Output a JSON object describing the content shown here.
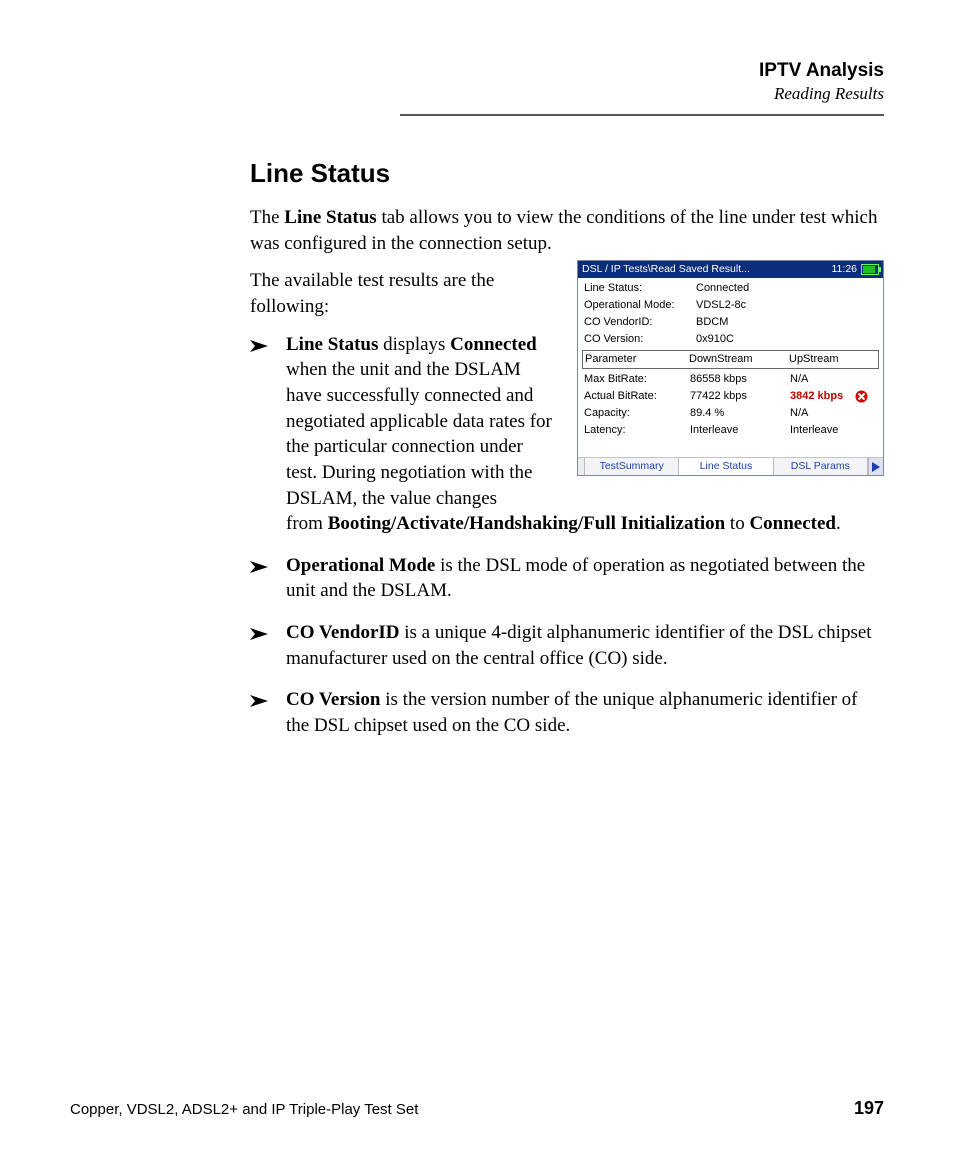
{
  "header": {
    "chapter": "IPTV Analysis",
    "section": "Reading Results"
  },
  "heading": "Line Status",
  "intro": {
    "sentence_part1": "The ",
    "sentence_bold": "Line Status",
    "sentence_part2": " tab allows you to view the conditions of the line under test which was configured in the connection setup.",
    "followup": "The available test results are the following:"
  },
  "bullets": [
    {
      "lead_bold": "Line Status",
      "lead_rest": " displays ",
      "lead_bold2": "Connected",
      "body_narrow": " when the unit and the DSLAM have successfully connected and negotiated applicable data rates for the particular connection under test. During negotiation with the DSLAM, the value changes",
      "body_full_part1": "from ",
      "body_full_bold": "Booting/Activate/Handshaking/Full Initialization",
      "body_full_part2": " to ",
      "body_full_bold2": "Connected",
      "body_full_part3": "."
    },
    {
      "lead_bold": "Operational Mode",
      "rest": " is the DSL mode of operation as negotiated between the unit and the DSLAM."
    },
    {
      "lead_bold": "CO VendorID",
      "rest": " is a unique 4-digit alphanumeric identifier of the DSL chipset manufacturer used on the central office (CO) side."
    },
    {
      "lead_bold": "CO Version",
      "rest": " is the version number of the unique alphanumeric identifier of the DSL chipset used on the CO side."
    }
  ],
  "device": {
    "title": "DSL / IP Tests\\Read Saved Result...",
    "clock": "11:26",
    "fields": {
      "line_status": {
        "label": "Line Status:",
        "value": "Connected"
      },
      "op_mode": {
        "label": "Operational Mode:",
        "value": "VDSL2-8c"
      },
      "co_vendor": {
        "label": "CO VendorID:",
        "value": "BDCM"
      },
      "co_version": {
        "label": "CO Version:",
        "value": "0x910C"
      }
    },
    "table": {
      "headers": [
        "Parameter",
        "DownStream",
        "UpStream"
      ],
      "rows": [
        {
          "p": "Max BitRate:",
          "d": "86558  kbps",
          "u": "N/A",
          "err": false
        },
        {
          "p": "Actual BitRate:",
          "d": "77422  kbps",
          "u": "3842  kbps",
          "err": true
        },
        {
          "p": "Capacity:",
          "d": "89.4  %",
          "u": "N/A",
          "err": false
        },
        {
          "p": "Latency:",
          "d": "Interleave",
          "u": "Interleave",
          "err": false
        }
      ]
    },
    "tabs": [
      "TestSummary",
      "Line Status",
      "DSL Params"
    ]
  },
  "footer": {
    "left": "Copper, VDSL2, ADSL2+ and IP Triple-Play Test Set",
    "page": "197"
  }
}
